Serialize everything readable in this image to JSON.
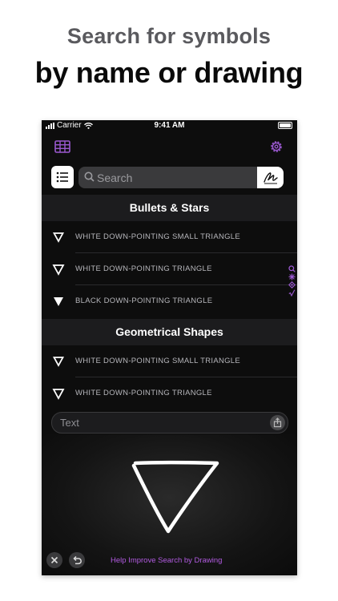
{
  "marketing": {
    "headline_line1": "Search for symbols",
    "headline_line2": "by name or drawing"
  },
  "status_bar": {
    "carrier": "Carrier",
    "time": "9:41 AM"
  },
  "nav": {
    "left_icon": "grid-icon",
    "right_icon": "gear-icon",
    "accent_color": "#9b59d0"
  },
  "search": {
    "placeholder": "Search",
    "list_icon": "list-icon",
    "draw_icon": "draw-icon"
  },
  "index_bar": [
    "Q",
    "✻",
    "◈",
    "√"
  ],
  "sections": [
    {
      "title": "Bullets & Stars",
      "items": [
        {
          "glyph": "▿",
          "label": "WHITE DOWN-POINTING SMALL TRIANGLE"
        },
        {
          "glyph": "▽",
          "label": "WHITE DOWN-POINTING TRIANGLE"
        },
        {
          "glyph": "▼",
          "label": "BLACK DOWN-POINTING TRIANGLE"
        }
      ]
    },
    {
      "title": "Geometrical Shapes",
      "items": [
        {
          "glyph": "▿",
          "label": "WHITE DOWN-POINTING SMALL TRIANGLE"
        },
        {
          "glyph": "▽",
          "label": "WHITE DOWN-POINTING TRIANGLE"
        }
      ]
    }
  ],
  "text_input": {
    "placeholder": "Text",
    "share_icon": "share-icon"
  },
  "drawing": {
    "help_link": "Help Improve Search by Drawing",
    "clear_icon": "close-icon",
    "undo_icon": "undo-icon",
    "link_color": "#b15be0"
  }
}
